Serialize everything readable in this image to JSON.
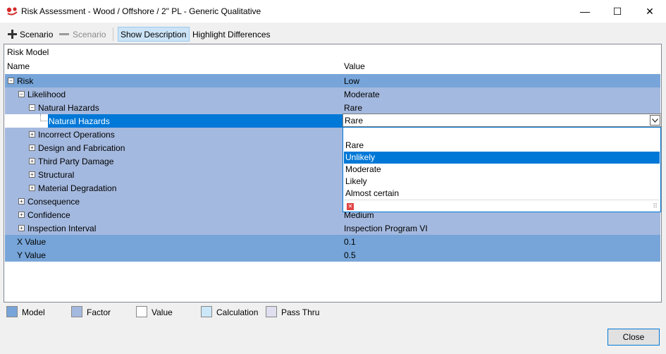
{
  "window": {
    "title": "Risk Assessment - Wood / Offshore / 2\" PL - Generic Qualitative",
    "minimize": "—",
    "maximize": "☐",
    "close": "✕"
  },
  "toolbar": {
    "add_scenario": "Scenario",
    "remove_scenario": "Scenario",
    "show_description": "Show Description",
    "highlight_differences": "Highlight Differences"
  },
  "panel": {
    "title": "Risk Model",
    "col_name": "Name",
    "col_value": "Value"
  },
  "rows": [
    {
      "name": "Risk",
      "value": "Low"
    },
    {
      "name": "Likelihood",
      "value": "Moderate"
    },
    {
      "name": "Natural Hazards",
      "value": "Rare"
    },
    {
      "name": "Natural Hazards",
      "value": "Rare"
    },
    {
      "name": "Incorrect Operations",
      "value": ""
    },
    {
      "name": "Design and Fabrication",
      "value": ""
    },
    {
      "name": "Third Party Damage",
      "value": ""
    },
    {
      "name": "Structural",
      "value": ""
    },
    {
      "name": "Material Degradation",
      "value": ""
    },
    {
      "name": "Consequence",
      "value": ""
    },
    {
      "name": "Confidence",
      "value": "Medium"
    },
    {
      "name": "Inspection Interval",
      "value": "Inspection Program VI"
    },
    {
      "name": "X Value",
      "value": "0.1"
    },
    {
      "name": "Y Value",
      "value": "0.5"
    }
  ],
  "dropdown": {
    "selected": "Rare",
    "options": [
      "",
      "Rare",
      "Unlikely",
      "Moderate",
      "Likely",
      "Almost certain"
    ],
    "highlighted": "Unlikely"
  },
  "legend": [
    "Model",
    "Factor",
    "Value",
    "Calculation",
    "Pass Thru"
  ],
  "colors": {
    "model": "#77a5d9",
    "factor": "#a4b9df",
    "value": "#ffffff",
    "calculation": "#cce8f8",
    "pass_thru": "#e0dff0",
    "selection": "#0078d7"
  },
  "footer": {
    "close": "Close"
  }
}
